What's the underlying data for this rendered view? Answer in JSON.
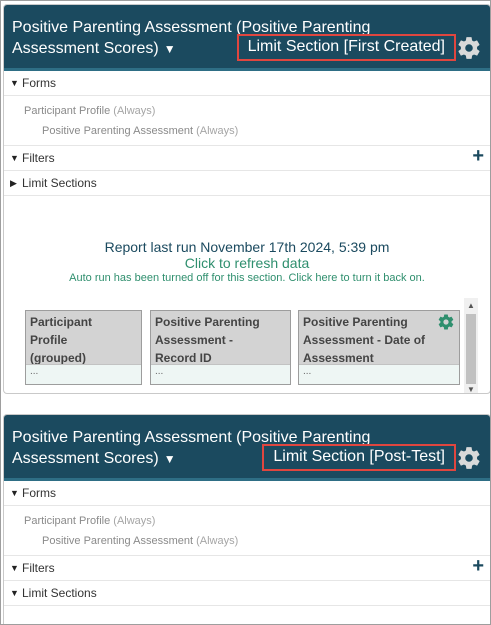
{
  "panels": [
    {
      "title": "Positive Parenting Assessment (Positive Parenting Assessment Scores)",
      "limit_section": "Limit Section [First Created]",
      "forms_label": "Forms",
      "form_items": [
        {
          "name": "Participant Profile",
          "note": "(Always)"
        },
        {
          "name": "Positive Parenting Assessment",
          "note": "(Always)"
        }
      ],
      "filters_label": "Filters",
      "limit_sections_label": "Limit Sections"
    },
    {
      "title": "Positive Parenting Assessment (Positive Parenting Assessment Scores)",
      "limit_section": "Limit Section [Post-Test]",
      "forms_label": "Forms",
      "form_items": [
        {
          "name": "Participant Profile",
          "note": "(Always)"
        },
        {
          "name": "Positive Parenting Assessment",
          "note": "(Always)"
        }
      ],
      "filters_label": "Filters",
      "limit_sections_label": "Limit Sections"
    }
  ],
  "report": {
    "last_run": "Report last run November 17th 2024, 5:39 pm",
    "refresh": "Click to refresh data",
    "autorun": "Auto run has been turned off for this section. Click here to turn it back on."
  },
  "columns": [
    {
      "header_lines": [
        "Participant",
        "Profile",
        "(grouped)"
      ],
      "cell": "..."
    },
    {
      "header_lines": [
        "Positive Parenting",
        "Assessment -",
        "Record ID"
      ],
      "cell": "..."
    },
    {
      "header_lines": [
        "Positive Parenting",
        "Assessment - Date of",
        "Assessment"
      ],
      "cell": "..."
    }
  ],
  "icons": {
    "dropdown": "caret-down-icon",
    "settings": "gear-icon",
    "expanded": "triangle-down-icon",
    "collapsed": "triangle-right-icon",
    "add": "plus-icon"
  },
  "colors": {
    "header_bg": "#1b4a5f",
    "highlight_border": "#e0463f",
    "accent_green": "#2f8f6e"
  }
}
